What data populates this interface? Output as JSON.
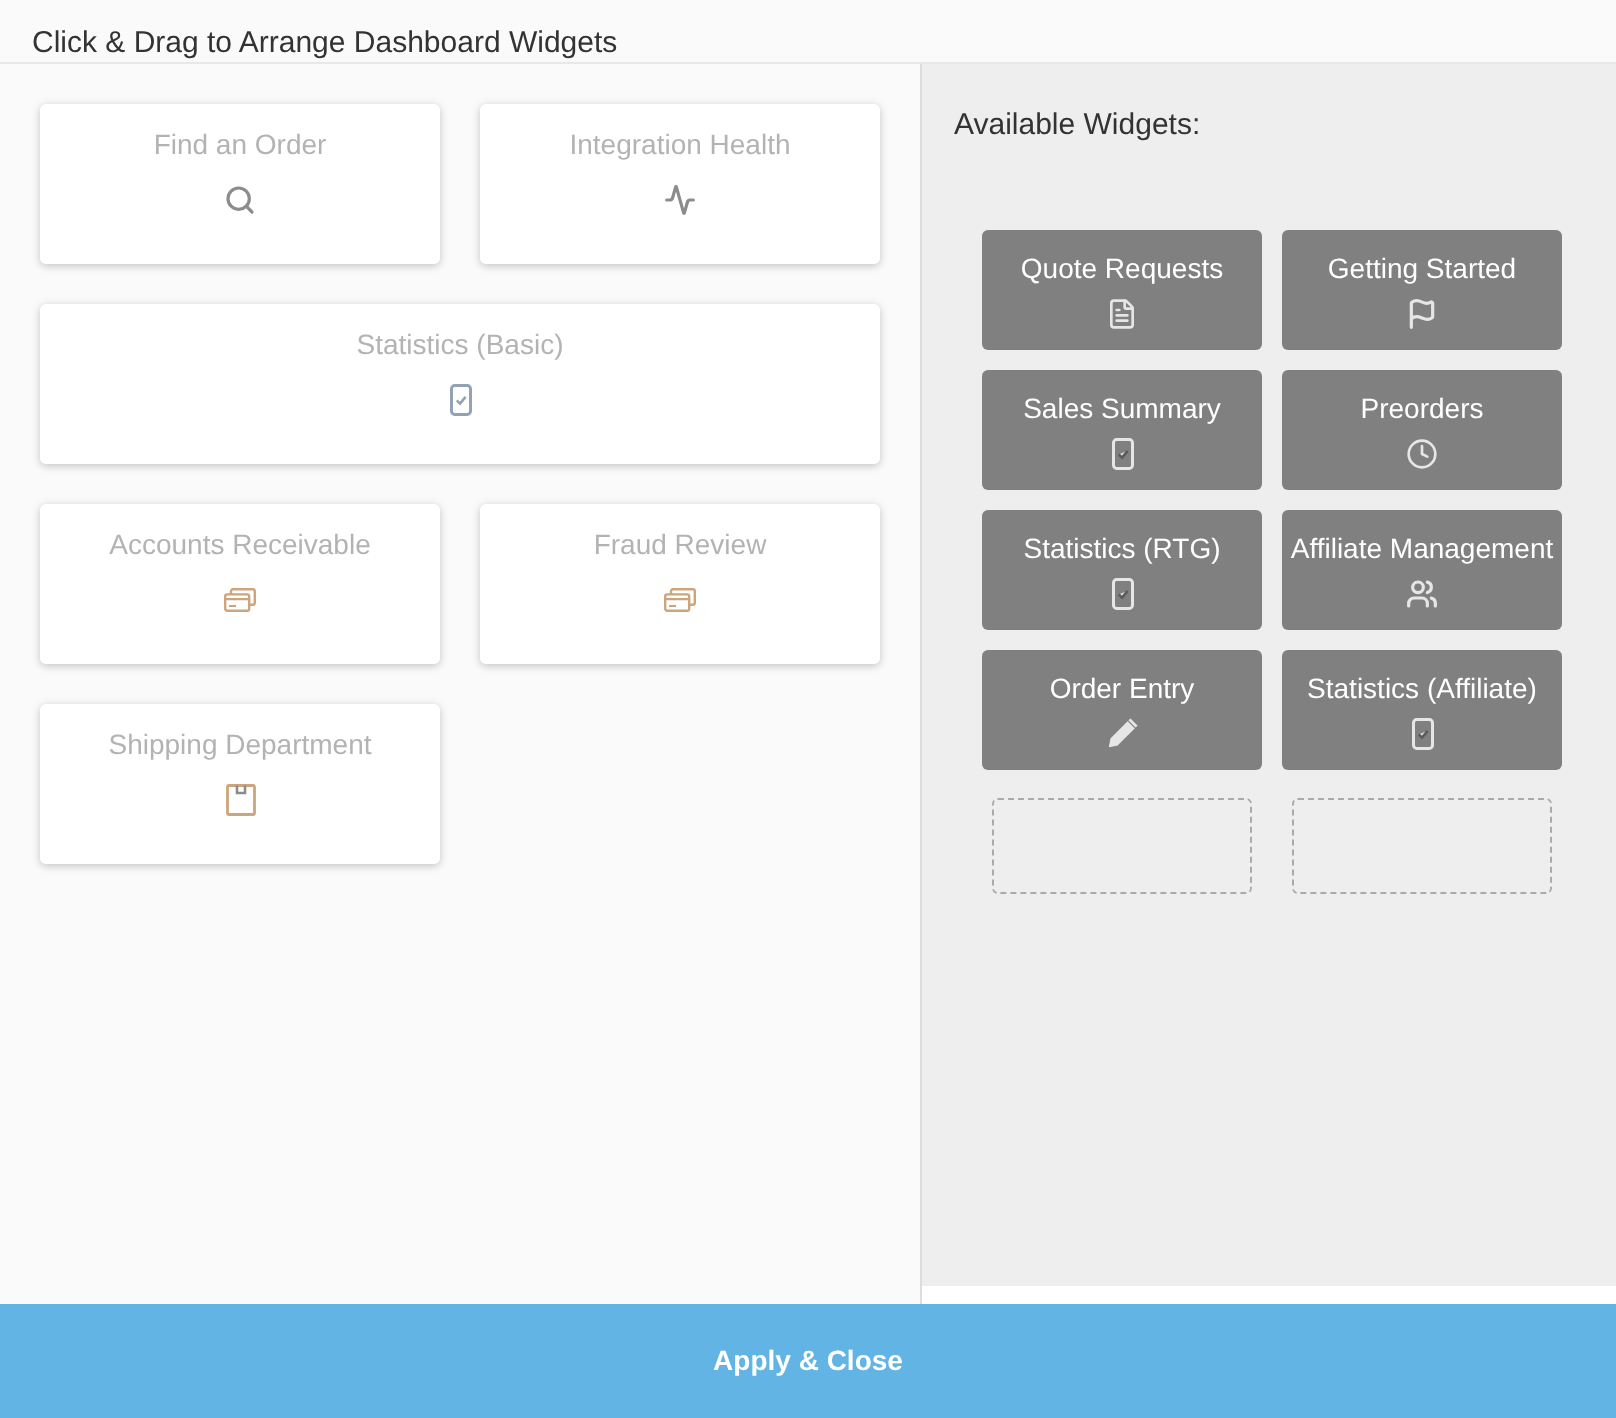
{
  "header": {
    "title": "Click & Drag to Arrange Dashboard Widgets"
  },
  "dashboard": {
    "widgets": [
      {
        "label": "Find an Order",
        "kind": "search",
        "wide": false
      },
      {
        "label": "Integration Health",
        "kind": "pulse",
        "wide": false
      },
      {
        "label": "Statistics (Basic)",
        "kind": "phone",
        "wide": true
      },
      {
        "label": "Accounts Receivable",
        "kind": "cards",
        "wide": false
      },
      {
        "label": "Fraud Review",
        "kind": "cards",
        "wide": false
      },
      {
        "label": "Shipping Department",
        "kind": "box",
        "wide": false
      }
    ]
  },
  "available": {
    "title": "Available Widgets:",
    "widgets": [
      {
        "label": "Quote Requests",
        "kind": "document"
      },
      {
        "label": "Getting Started",
        "kind": "flag"
      },
      {
        "label": "Sales Summary",
        "kind": "phone"
      },
      {
        "label": "Preorders",
        "kind": "clock"
      },
      {
        "label": "Statistics (RTG)",
        "kind": "phone"
      },
      {
        "label": "Affiliate Management",
        "kind": "users"
      },
      {
        "label": "Order Entry",
        "kind": "pencil"
      },
      {
        "label": "Statistics (Affiliate)",
        "kind": "phone"
      },
      {
        "kind": "empty"
      },
      {
        "kind": "empty"
      }
    ]
  },
  "footer": {
    "button": "Apply & Close"
  }
}
